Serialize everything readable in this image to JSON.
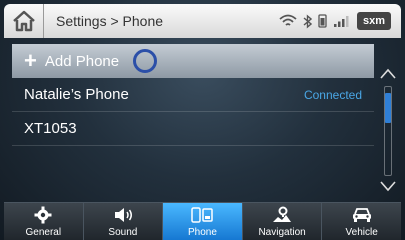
{
  "header": {
    "breadcrumb": "Settings > Phone",
    "sxm_label": "sxm"
  },
  "list": {
    "add_label": "Add Phone",
    "phones": [
      {
        "name": "Natalie’s Phone",
        "status": "Connected"
      },
      {
        "name": "XT1053",
        "status": ""
      }
    ]
  },
  "scrollbar": {
    "position": 0.1
  },
  "tabs": [
    {
      "label": "General",
      "icon": "gear-icon",
      "active": false
    },
    {
      "label": "Sound",
      "icon": "speaker-icon",
      "active": false
    },
    {
      "label": "Phone",
      "icon": "phone-icon",
      "active": true
    },
    {
      "label": "Navigation",
      "icon": "navigation-icon",
      "active": false
    },
    {
      "label": "Vehicle",
      "icon": "car-icon",
      "active": false
    }
  ],
  "colors": {
    "accent": "#2f7fd6",
    "connected": "#4aa7e6",
    "active_tab": "#2e9bee"
  }
}
